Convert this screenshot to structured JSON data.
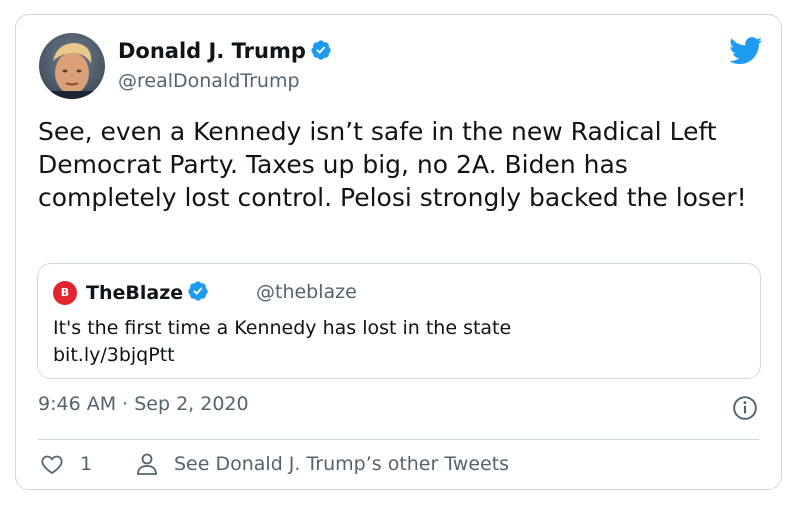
{
  "author": {
    "name": "Donald J. Trump",
    "handle": "@realDonaldTrump",
    "verified": true
  },
  "tweet": {
    "text": "See, even a Kennedy isn’t safe in the new Radical Left Democrat Party. Taxes up big, no 2A. Biden has completely lost control. Pelosi strongly backed the loser!",
    "timestamp": "9:46 AM · Sep 2, 2020",
    "like_count": "1",
    "other_tweets_label": "See Donald J. Trump’s other Tweets"
  },
  "quoted_tweet": {
    "name": "TheBlaze",
    "handle": "@theblaze",
    "avatar_letter": "B",
    "verified": true,
    "text_line1": "It's the first time a Kennedy has lost in the state",
    "text_line2": "bit.ly/3bjqPtt"
  },
  "icons": {
    "brand": "twitter-bird-icon",
    "verified": "verified-badge-icon",
    "info": "info-icon",
    "like": "heart-icon",
    "profile": "person-icon"
  },
  "colors": {
    "twitter_blue": "#1d9bf0",
    "text": "#0f1419",
    "secondary_text": "#536471",
    "border": "#cfd9de",
    "blaze_red": "#e2262e"
  }
}
